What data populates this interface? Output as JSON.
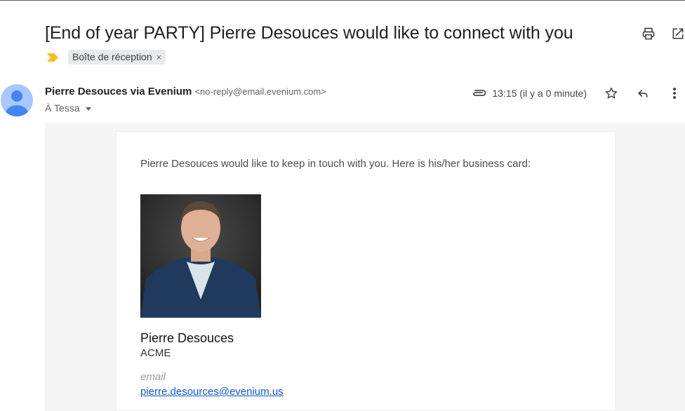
{
  "email": {
    "subject": "[End of year PARTY] Pierre Desouces would like to connect with you",
    "label_chip": "Boîte de réception",
    "label_close": "×",
    "sender": {
      "name": "Pierre Desouces via Evenium",
      "address": "<no-reply@email.evenium.com>"
    },
    "recipient": "À Tessa",
    "time": "13:15 (il y a 0 minute)"
  },
  "message": {
    "intro": "Pierre Desouces would like to keep in touch with you. Here is his/her business card:",
    "card": {
      "name": "Pierre Desouces",
      "company": "ACME",
      "email_label": "email",
      "email": "pierre.desources@evenium.us"
    }
  },
  "icons": {
    "header": [
      "print-icon",
      "open-in-new-window-icon"
    ],
    "meta": [
      "attachment-icon",
      "star-icon",
      "reply-icon",
      "more-vert-icon"
    ],
    "label": "important-marker-icon"
  },
  "colors": {
    "important_marker": "#f6bf26",
    "link": "#1155cc",
    "chip_bg": "#e8eaed",
    "avatar_bg": "#a8c7fa",
    "avatar_fg": "#4285f4",
    "body_bg": "#f4f4f4"
  }
}
